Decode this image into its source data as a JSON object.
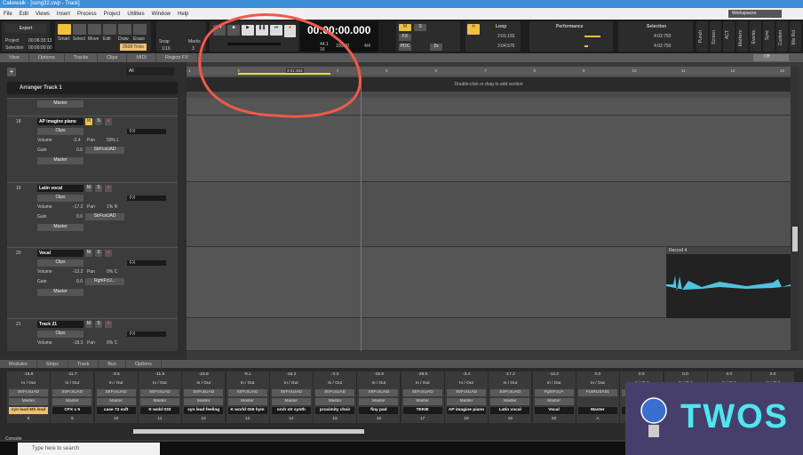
{
  "window": {
    "title": "Cakewalk - [song32.cwp - Track]"
  },
  "menu": [
    "File",
    "Edit",
    "Views",
    "Insert",
    "Process",
    "Project",
    "Utilities",
    "Window",
    "Help"
  ],
  "workspaces": "Workspaces",
  "toolbar": {
    "export": "Export",
    "project_label": "Project",
    "project_time": "00:06:33:13",
    "selection_label": "Selection",
    "selection_time": "00:00:00:00",
    "tools": [
      "Smart",
      "Select",
      "Move",
      "Edit",
      "Draw",
      "Erase"
    ],
    "ticks": "2938 Ticks",
    "snap": "Snap",
    "marks": "Marks",
    "snap_value": "1/16",
    "snap_num": "3",
    "time": "00:00:00.000",
    "sample_rate": "44.1",
    "bits": "16",
    "tempo": "100.00",
    "meter": "4/4",
    "mix_buttons": [
      "M",
      "S",
      "FX",
      "PDC",
      "2x"
    ],
    "loop": {
      "title": "Loop",
      "start": "2:01:192",
      "end": "3:04:576"
    },
    "performance": {
      "title": "Performance"
    },
    "selection": {
      "title": "Selection",
      "start": "4:02:750",
      "end": "4:02:750"
    },
    "side_modules": [
      "Punch",
      "Screen",
      "ACT",
      "Markers",
      "Events",
      "Sync",
      "Custom",
      "Mix Rcl"
    ],
    "off": "Off"
  },
  "track_view_menu": [
    "View",
    "Options",
    "Tracks",
    "Clips",
    "MIDI",
    "Region FX"
  ],
  "track_filter": "All",
  "arranger": {
    "name": "Arranger Track 1",
    "hint": "Double-click or drag to add section"
  },
  "ruler": [
    "1",
    "2",
    "3",
    "4",
    "5",
    "6",
    "7",
    "8",
    "9",
    "10",
    "11",
    "12",
    "13"
  ],
  "ruler_marker": "3:01:263",
  "accent": "#f0c040",
  "tracks": [
    {
      "num": "18",
      "name": "AP imagine piano",
      "volume": "-3.4",
      "pan": "50% L",
      "gain": "0.0",
      "input": "StrFcsUAD",
      "output": "Master",
      "muted": true
    },
    {
      "num": "19",
      "name": "Latin vocal",
      "volume": "-17.2",
      "pan": "1% R",
      "gain": "0.0",
      "input": "StrFcsUAD",
      "output": "Master",
      "muted": false
    },
    {
      "num": "20",
      "name": "Vocal",
      "volume": "-12.2",
      "pan": "0% C",
      "gain": "0.0",
      "input": "RghtFcU...",
      "output": "Master",
      "muted": false
    },
    {
      "num": "21",
      "name": "Track 21",
      "volume": "-18.3",
      "pan": "0% C",
      "gain": "",
      "input": "",
      "output": "",
      "muted": false
    }
  ],
  "track_labels": {
    "clips": "Clips",
    "volume": "Volume",
    "pan": "Pan",
    "gain": "Gain",
    "fx": "FX",
    "master": "Master"
  },
  "clip": {
    "name": "Record 4",
    "color": "#4fc3e0"
  },
  "console": {
    "menu": [
      "Modules",
      "Strips",
      "Track",
      "Bus",
      "Options"
    ],
    "inout": "In / Out",
    "strips": [
      {
        "vol": "-15.8",
        "in": "StrFcsUAD",
        "out": "Master",
        "name": "syn lead 6th lead",
        "num": "8"
      },
      {
        "vol": "-11.7",
        "in": "StrFcsUAD",
        "out": "Master",
        "name": "CFX x 5",
        "num": "9"
      },
      {
        "vol": "-3.5",
        "in": "StrFcsUAD",
        "out": "Master",
        "name": "case 73 soft",
        "num": "10"
      },
      {
        "vol": "-11.9",
        "in": "StrFcsUAD",
        "out": "Master",
        "name": "K wold 033",
        "num": "11"
      },
      {
        "vol": "-16.8",
        "in": "StrFcsUAD",
        "out": "Master",
        "name": "syn lead feeling",
        "num": "12"
      },
      {
        "vol": "-8.1",
        "in": "StrFcsUAD",
        "out": "Master",
        "name": "K world 026 hym",
        "num": "13"
      },
      {
        "vol": "-16.2",
        "in": "StrFcsUAD",
        "out": "Master",
        "name": "orch str synth",
        "num": "14"
      },
      {
        "vol": "-3.3",
        "in": "StrFcsUAD",
        "out": "Master",
        "name": "proximity choir",
        "num": "15"
      },
      {
        "vol": "-18.9",
        "in": "StrFcsUAD",
        "out": "Master",
        "name": "finy pad",
        "num": "16"
      },
      {
        "vol": "-29.5",
        "in": "StrFcsUAD",
        "out": "Master",
        "name": "TEKIE",
        "num": "17"
      },
      {
        "vol": "-3.4",
        "in": "StrFcsUAD",
        "out": "Master",
        "name": "AP imagine piano",
        "num": "18"
      },
      {
        "vol": "-17.2",
        "in": "StrFcsUAD",
        "out": "Master",
        "name": "Latin vocal",
        "num": "19"
      },
      {
        "vol": "-12.2",
        "in": "RghtFcUA",
        "out": "Master",
        "name": "Vocal",
        "num": "20"
      },
      {
        "vol": "0.0",
        "in": "FcsRUSA01",
        "out": "",
        "name": "Master",
        "num": "A"
      },
      {
        "vol": "0.0",
        "in": "Ma",
        "out": "",
        "name": "Met",
        "num": ""
      },
      {
        "vol": "0.0",
        "in": "",
        "out": "",
        "name": "",
        "num": ""
      },
      {
        "vol": "0.0",
        "in": "",
        "out": "",
        "name": "",
        "num": ""
      },
      {
        "vol": "0.0",
        "in": "",
        "out": "",
        "name": "",
        "num": ""
      }
    ],
    "tab": "Console"
  },
  "taskbar": {
    "search_placeholder": "Type here to search"
  },
  "watermark": "TWOS",
  "annotation_color": "#f05a4a"
}
